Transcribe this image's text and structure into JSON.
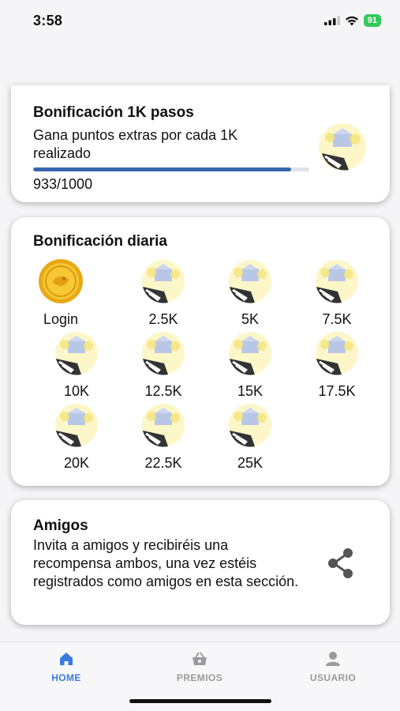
{
  "status_bar": {
    "time": "3:58",
    "battery": "91"
  },
  "bonus_1k": {
    "title": "Bonificación 1K pasos",
    "description": "Gana puntos extras por cada 1K realizado",
    "progress_text": "933/1000",
    "progress_fraction": 0.933
  },
  "daily": {
    "title": "Bonificación diaria",
    "items": [
      {
        "label": "Login",
        "icon": "gold-coin-icon"
      },
      {
        "label": "2.5K",
        "icon": "medal-icon"
      },
      {
        "label": "5K",
        "icon": "medal-icon"
      },
      {
        "label": "7.5K",
        "icon": "medal-icon"
      },
      {
        "label": "10K",
        "icon": "medal-icon"
      },
      {
        "label": "12.5K",
        "icon": "medal-icon"
      },
      {
        "label": "15K",
        "icon": "medal-icon"
      },
      {
        "label": "17.5K",
        "icon": "medal-icon"
      },
      {
        "label": "20K",
        "icon": "medal-icon"
      },
      {
        "label": "22.5K",
        "icon": "medal-icon"
      },
      {
        "label": "25K",
        "icon": "medal-icon"
      }
    ]
  },
  "friends": {
    "title": "Amigos",
    "description": "Invita a amigos y recibiréis una recompensa ambos, una vez estéis registrados como amigos en esta sección.",
    "icon": "share-icon"
  },
  "tabs": [
    {
      "label": "HOME",
      "icon": "home-icon",
      "active": true
    },
    {
      "label": "PREMIOS",
      "icon": "basket-icon",
      "active": false
    },
    {
      "label": "USUARIO",
      "icon": "user-icon",
      "active": false
    }
  ],
  "colors": {
    "accent": "#3a7be0",
    "progress": "#3766b0",
    "inactive_tab": "#9a9a9e",
    "battery": "#34c759"
  }
}
